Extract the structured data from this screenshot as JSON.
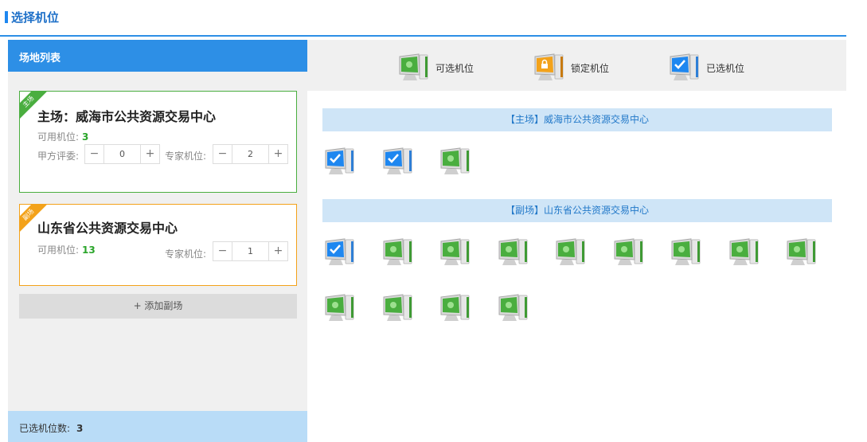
{
  "page": {
    "title": "选择机位"
  },
  "left": {
    "header": "场地列表",
    "main_venue": {
      "ribbon": "主场",
      "name": "主场：威海市公共资源交易中心",
      "available_label": "可用机位:",
      "available_count": "3",
      "owner_label": "甲方评委:",
      "owner_value": "0",
      "expert_label": "专家机位:",
      "expert_value": "2"
    },
    "sub_venue": {
      "ribbon": "副场",
      "name": "山东省公共资源交易中心",
      "available_label": "可用机位:",
      "available_count": "13",
      "expert_label": "专家机位:",
      "expert_value": "1"
    },
    "add_button": "+ 添加副场",
    "footer_label": "已选机位数:",
    "footer_count": "3"
  },
  "legend": {
    "available": "可选机位",
    "locked": "锁定机位",
    "selected": "已选机位"
  },
  "sections": {
    "main_title": "【主场】威海市公共资源交易中心",
    "sub_title": "【副场】山东省公共资源交易中心",
    "main_seats": [
      "selected",
      "selected",
      "available"
    ],
    "sub_seats": [
      "selected",
      "available",
      "available",
      "available",
      "available",
      "available",
      "available",
      "available",
      "available",
      "available",
      "available",
      "available",
      "available"
    ]
  },
  "colors": {
    "primary": "#2d8fe6",
    "available": "#4aae3f",
    "locked": "#f3a21a",
    "selected": "#1e87f0"
  }
}
